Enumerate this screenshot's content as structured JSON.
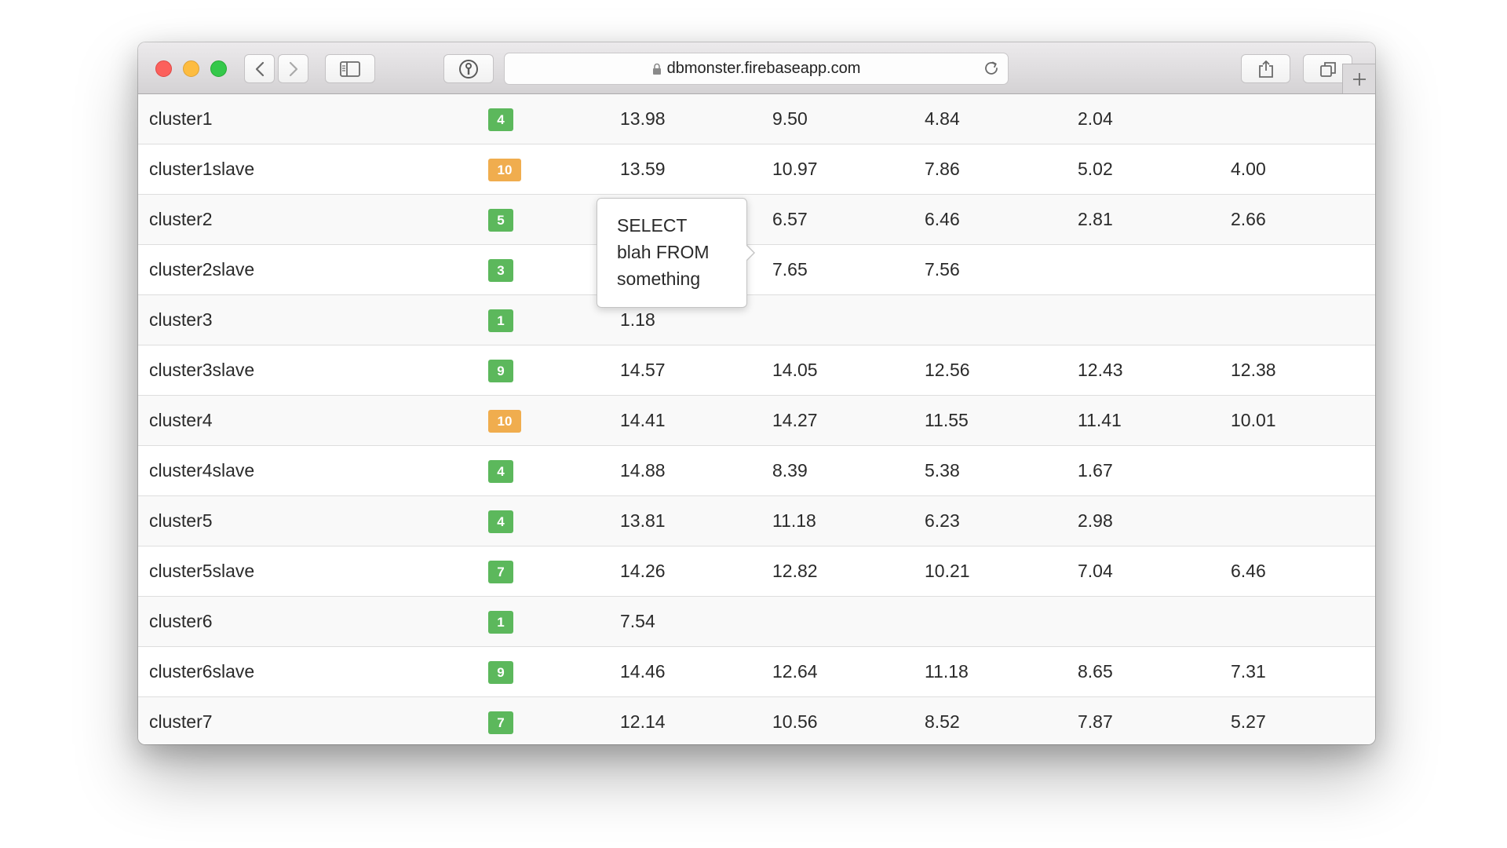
{
  "browser": {
    "url": "dbmonster.firebaseapp.com",
    "icons": [
      "back-icon",
      "forward-icon",
      "sidebar-icon",
      "password-icon",
      "lock-icon",
      "reload-icon",
      "share-icon",
      "tabs-icon",
      "new-tab-icon"
    ]
  },
  "colors": {
    "badge_green": "#5cb85c",
    "badge_orange": "#f0ad4e"
  },
  "rows": [
    {
      "name": "cluster1",
      "count": "4",
      "status": "green",
      "queries": [
        "13.98",
        "9.50",
        "4.84",
        "2.04",
        ""
      ]
    },
    {
      "name": "cluster1slave",
      "count": "10",
      "status": "orange",
      "queries": [
        "13.59",
        "10.97",
        "7.86",
        "5.02",
        "4.00"
      ]
    },
    {
      "name": "cluster2",
      "count": "5",
      "status": "green",
      "queries": [
        "",
        "6.57",
        "6.46",
        "2.81",
        "2.66"
      ]
    },
    {
      "name": "cluster2slave",
      "count": "3",
      "status": "green",
      "queries": [
        "",
        "7.65",
        "7.56",
        "",
        ""
      ]
    },
    {
      "name": "cluster3",
      "count": "1",
      "status": "green",
      "queries": [
        "1.18",
        "",
        "",
        "",
        ""
      ]
    },
    {
      "name": "cluster3slave",
      "count": "9",
      "status": "green",
      "queries": [
        "14.57",
        "14.05",
        "12.56",
        "12.43",
        "12.38"
      ]
    },
    {
      "name": "cluster4",
      "count": "10",
      "status": "orange",
      "queries": [
        "14.41",
        "14.27",
        "11.55",
        "11.41",
        "10.01"
      ]
    },
    {
      "name": "cluster4slave",
      "count": "4",
      "status": "green",
      "queries": [
        "14.88",
        "8.39",
        "5.38",
        "1.67",
        ""
      ]
    },
    {
      "name": "cluster5",
      "count": "4",
      "status": "green",
      "queries": [
        "13.81",
        "11.18",
        "6.23",
        "2.98",
        ""
      ]
    },
    {
      "name": "cluster5slave",
      "count": "7",
      "status": "green",
      "queries": [
        "14.26",
        "12.82",
        "10.21",
        "7.04",
        "6.46"
      ]
    },
    {
      "name": "cluster6",
      "count": "1",
      "status": "green",
      "queries": [
        "7.54",
        "",
        "",
        "",
        ""
      ]
    },
    {
      "name": "cluster6slave",
      "count": "9",
      "status": "green",
      "queries": [
        "14.46",
        "12.64",
        "11.18",
        "8.65",
        "7.31"
      ]
    },
    {
      "name": "cluster7",
      "count": "7",
      "status": "green",
      "queries": [
        "12.14",
        "10.56",
        "8.52",
        "7.87",
        "5.27"
      ]
    }
  ],
  "popover": {
    "lines": [
      "SELECT",
      "blah FROM",
      "something"
    ]
  }
}
